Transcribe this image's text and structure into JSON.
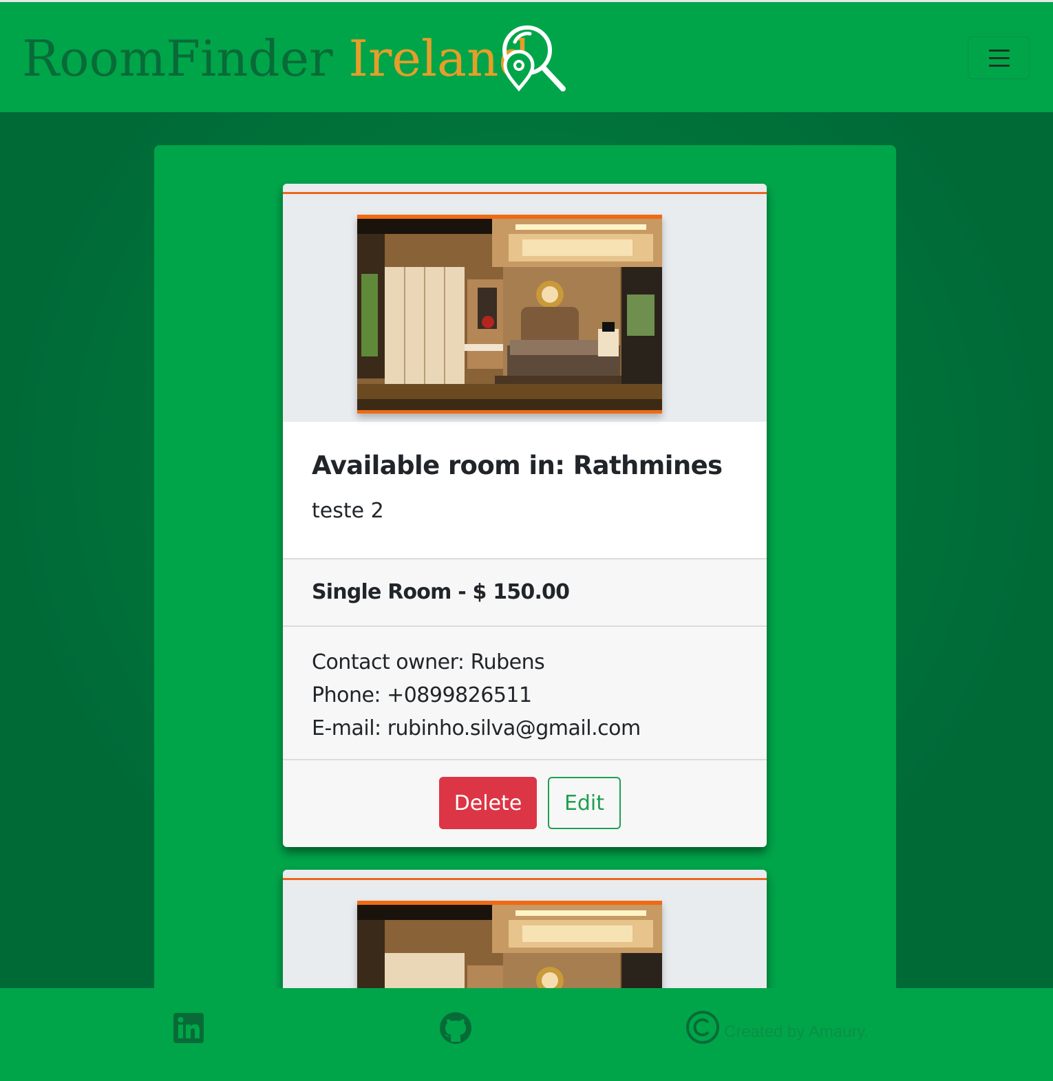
{
  "brand": {
    "part1": "RoomFinder",
    "part2": "Ireland",
    "logo_icon": "location-search-icon"
  },
  "navbar": {
    "toggler_icon": "hamburger-menu-icon"
  },
  "listings": [
    {
      "title": "Available room in: Rathmines",
      "description": "teste 2",
      "price_line": "Single Room - $ 150.00",
      "contact_owner": "Contact owner: Rubens",
      "phone": "Phone: +0899826511",
      "email": "E-mail: rubinho.silva@gmail.com",
      "image": "bedroom-photo",
      "delete_label": "Delete",
      "edit_label": "Edit"
    },
    {
      "image": "bedroom-photo"
    }
  ],
  "footer": {
    "linkedin_icon": "linkedin-icon",
    "github_icon": "github-icon",
    "copyright_icon": "copyright-icon",
    "credit": "Created by Amaury."
  },
  "colors": {
    "navbar": "#00a54a",
    "page_bg": "#006a37",
    "brand_primary": "#086b37",
    "brand_accent": "#e59e2a",
    "card_accent": "#ec6519",
    "delete": "#dc3545",
    "edit": "#1e9e4f"
  }
}
